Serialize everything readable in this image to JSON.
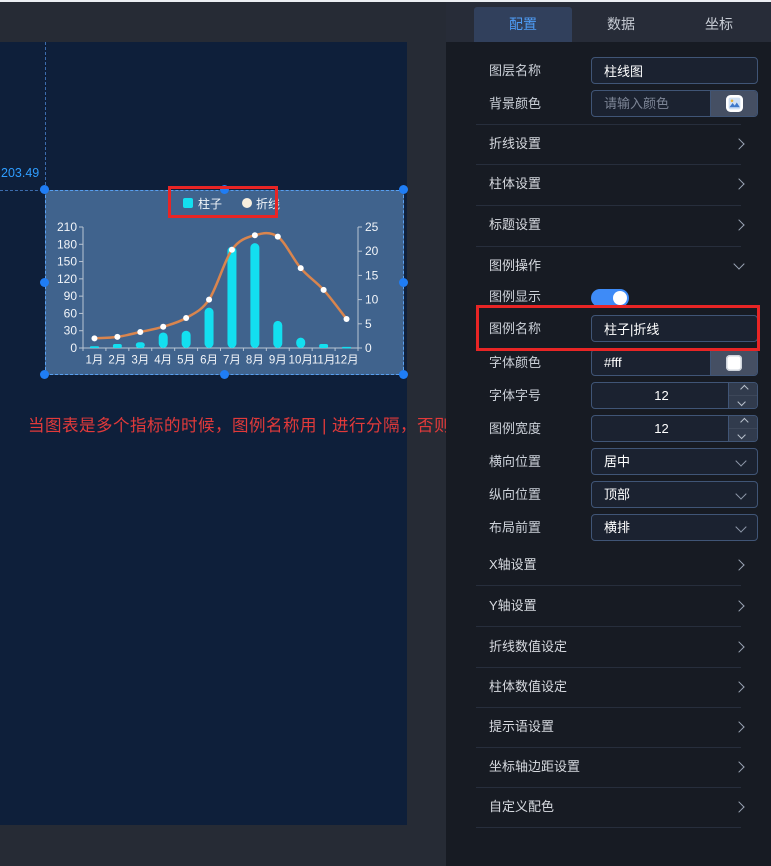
{
  "tabs": [
    {
      "label": "配置",
      "active": true
    },
    {
      "label": "数据",
      "active": false
    },
    {
      "label": "坐标",
      "active": false
    }
  ],
  "panel": {
    "fields": {
      "layer_name": {
        "label": "图层名称",
        "value": "柱线图"
      },
      "bg_color": {
        "label": "背景颜色",
        "placeholder": "请输入颜色"
      },
      "legend_show": {
        "label": "图例显示",
        "on": true
      },
      "legend_name": {
        "label": "图例名称",
        "value": "柱子|折线"
      },
      "font_color": {
        "label": "字体颜色",
        "value": "#fff"
      },
      "font_size": {
        "label": "字体字号",
        "value": "12"
      },
      "legend_width": {
        "label": "图例宽度",
        "value": "12"
      },
      "h_position": {
        "label": "横向位置",
        "value": "居中"
      },
      "v_position": {
        "label": "纵向位置",
        "value": "顶部"
      },
      "layout_front": {
        "label": "布局前置",
        "value": "横排"
      }
    },
    "sections": {
      "line": {
        "label": "折线设置",
        "expanded": false
      },
      "bar": {
        "label": "柱体设置",
        "expanded": false
      },
      "title": {
        "label": "标题设置",
        "expanded": false
      },
      "legend": {
        "label": "图例操作",
        "expanded": true
      },
      "x_axis": {
        "label": "X轴设置",
        "expanded": false
      },
      "y_axis": {
        "label": "Y轴设置",
        "expanded": false
      },
      "line_value": {
        "label": "折线数值设定",
        "expanded": false
      },
      "bar_value": {
        "label": "柱体数值设定",
        "expanded": false
      },
      "tooltip": {
        "label": "提示语设置",
        "expanded": false
      },
      "axis_margin": {
        "label": "坐标轴边距设置",
        "expanded": false
      },
      "custom_color": {
        "label": "自定义配色",
        "expanded": false
      }
    }
  },
  "canvas": {
    "coord_label": "203.49",
    "note": "当图表是多个指标的时候，图例名称用 | 进行分隔，否则不识别"
  },
  "colors": {
    "accent_blue": "#3e8bf7",
    "selection_blue": "#1f7df5",
    "annotation_red": "#e82525",
    "bar_color": "#13dff0",
    "line_color": "#d9854e",
    "widget_bg": "#40638d",
    "canvas_bg": "#0e1f3a"
  },
  "chart_data": {
    "type": "bar-line",
    "title": "",
    "xlabel": "",
    "ylabel": "",
    "categories": [
      "1月",
      "2月",
      "3月",
      "4月",
      "5月",
      "6月",
      "7月",
      "8月",
      "9月",
      "10月",
      "11月",
      "12月"
    ],
    "series": [
      {
        "name": "柱子",
        "type": "bar",
        "y_axis": "left",
        "color": "#13dff0",
        "values": [
          3,
          7,
          10,
          27,
          30,
          70,
          176,
          182,
          47,
          18,
          7,
          2
        ]
      },
      {
        "name": "折线",
        "type": "line",
        "y_axis": "right",
        "color": "#d9854e",
        "values": [
          2,
          2.3,
          3.3,
          4.4,
          6.2,
          10,
          20.3,
          23.3,
          23,
          16.5,
          12,
          6
        ]
      }
    ],
    "left_axis": {
      "min": 0,
      "max": 210,
      "step": 30
    },
    "right_axis": {
      "min": 0,
      "max": 25,
      "step": 5
    },
    "legend": {
      "position": "top-center",
      "labels": [
        "柱子",
        "折线"
      ]
    },
    "grid": false
  }
}
